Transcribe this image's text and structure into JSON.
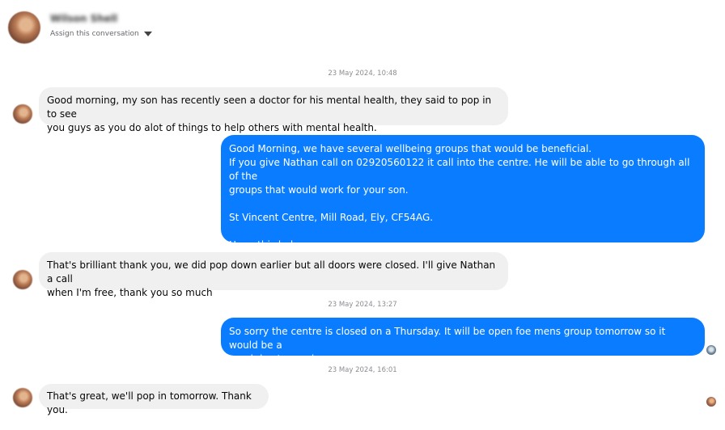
{
  "header": {
    "contact_name": "Wilson Shell",
    "assign_label": "Assign this conversation"
  },
  "timestamps": [
    "23 May 2024, 10:48",
    "23 May 2024, 13:27",
    "23 May 2024, 16:01"
  ],
  "messages": [
    {
      "direction": "incoming",
      "text": "Good morning, my son has recently seen a doctor for his mental health, they said to pop in to see\nyou guys as you do alot of things to help others with mental health."
    },
    {
      "direction": "outgoing",
      "text": "Good Morning, we have several wellbeing groups that would be beneficial.\nIf you give Nathan call  on 02920560122 it call into the centre. He will be able to go through all of the\ngroups that would work for your son.\n\nSt Vincent Centre, Mill Road, Ely, CF54AG.\n\nHope this helps."
    },
    {
      "direction": "incoming",
      "text": "That's brilliant thank you, we did pop down earlier but all doors were closed. I'll give Nathan a call\nwhen I'm free, thank you so much"
    },
    {
      "direction": "outgoing",
      "text": "So sorry the centre is closed on a Thursday. It will be open foe mens group tomorrow so it would be a\ngood day to pop in."
    },
    {
      "direction": "incoming",
      "text": "That's great, we'll pop in tomorrow. Thank you."
    }
  ],
  "colors": {
    "outgoing_bubble": "#0a7cff",
    "incoming_bubble": "#f0f0f0"
  }
}
